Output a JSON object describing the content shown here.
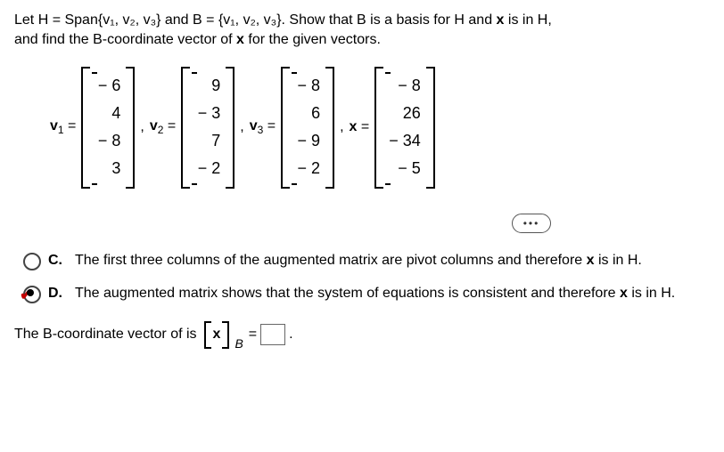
{
  "question": {
    "line1_pre": "Let H = Span",
    "set1": "{v₁, v₂, v₃}",
    "line1_mid": " and B = ",
    "set2": "{v₁, v₂, v₃}",
    "line1_post": ". Show that B is a basis for H and ",
    "x": "x",
    "line1_end": " is in H,",
    "line2": "and find the B-coordinate vector of ",
    "line2_end": " for the given vectors."
  },
  "vectors": {
    "v1_label": "v",
    "v1_sub": "1",
    "eq": " = ",
    "v2_label": "v",
    "v2_sub": "2",
    "v3_label": "v",
    "v3_sub": "3",
    "x_label": "x",
    "comma": ", ",
    "v1": [
      "− 6",
      "4",
      "− 8",
      "3"
    ],
    "v2": [
      "9",
      "− 3",
      "7",
      "− 2"
    ],
    "v3": [
      "− 8",
      "6",
      "− 9",
      "− 2"
    ],
    "x": [
      "− 8",
      "26",
      "− 34",
      "− 5"
    ]
  },
  "dots": "•••",
  "options": {
    "c_letter": "C.",
    "c_text": "The first three columns of the augmented matrix are pivot columns and therefore x is in H.",
    "d_letter": "D.",
    "d_text": "The augmented matrix shows that the system of equations is consistent and therefore x is in H."
  },
  "answer": {
    "pre": "The B-coordinate vector of is",
    "x": "x",
    "eq": " = ",
    "period": "."
  }
}
